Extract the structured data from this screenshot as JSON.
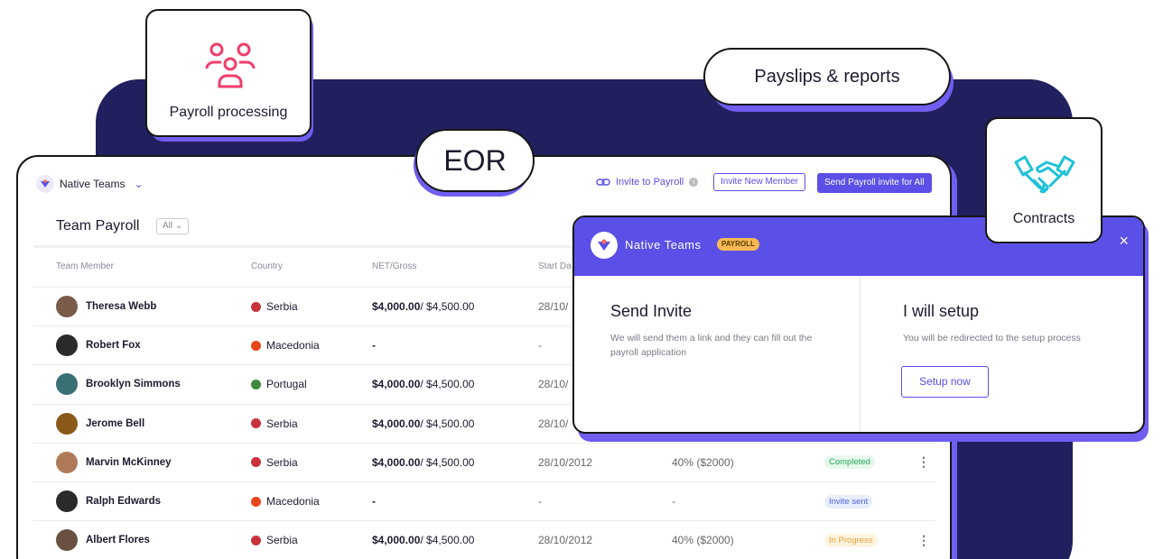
{
  "colors": {
    "brand": "#5a4fe6",
    "panel": "#221f5e",
    "accent_shadow": "#6f5ef0"
  },
  "cards": {
    "payroll_processing": {
      "label": "Payroll processing",
      "icon": "team-icon"
    },
    "payslips": {
      "label": "Payslips & reports"
    },
    "eor": {
      "label": "EOR"
    },
    "contracts": {
      "label": "Contracts",
      "icon": "handshake-icon"
    }
  },
  "app": {
    "brand": "Native Teams",
    "invite_link": "Invite to Payroll",
    "invite_new_member": "Invite New Member",
    "send_payroll_invite": "Send Payroll invite for All",
    "title": "Team Payroll",
    "filter": "All"
  },
  "table": {
    "headers": [
      "Team Member",
      "Country",
      "NET/Gross",
      "Start Da"
    ],
    "rows": [
      {
        "name": "Theresa Webb",
        "country": "Serbia",
        "net": "$4,000.00",
        "gross": " / $4,500.00",
        "date": "28/10/",
        "pct": "",
        "status": "",
        "status_type": "",
        "menu": false,
        "avatar": "#7a5a48",
        "flag": "#c8323c"
      },
      {
        "name": "Robert Fox",
        "country": "Macedonia",
        "net": "-",
        "gross": "",
        "date": "-",
        "pct": "",
        "status": "",
        "status_type": "",
        "menu": false,
        "avatar": "#2a2a2a",
        "flag": "#e8461b"
      },
      {
        "name": "Brooklyn Simmons",
        "country": "Portugal",
        "net": "$4,000.00",
        "gross": " / $4,500.00",
        "date": "28/10/",
        "pct": "",
        "status": "",
        "status_type": "",
        "menu": false,
        "avatar": "#3a6f74",
        "flag": "#3f8a3c"
      },
      {
        "name": "Jerome Bell",
        "country": "Serbia",
        "net": "$4,000.00",
        "gross": " / $4,500.00",
        "date": "28/10/",
        "pct": "",
        "status": "",
        "status_type": "",
        "menu": false,
        "avatar": "#8a5a1a",
        "flag": "#c8323c"
      },
      {
        "name": "Marvin McKinney",
        "country": "Serbia",
        "net": "$4,000.00",
        "gross": " / $4,500.00",
        "date": "28/10/2012",
        "pct": "40% ($2000)",
        "status": "Completed",
        "status_type": "completed",
        "menu": true,
        "avatar": "#b07a5a",
        "flag": "#c8323c"
      },
      {
        "name": "Ralph Edwards",
        "country": "Macedonia",
        "net": "-",
        "gross": "",
        "date": "-",
        "pct": "-",
        "status": "Invite sent",
        "status_type": "sent",
        "menu": false,
        "avatar": "#2a2a2a",
        "flag": "#e8461b"
      },
      {
        "name": "Albert Flores",
        "country": "Serbia",
        "net": "$4,000.00",
        "gross": " / $4,500.00",
        "date": "28/10/2012",
        "pct": "40% ($2000)",
        "status": "In Progress",
        "status_type": "progress",
        "menu": true,
        "avatar": "#6a5040",
        "flag": "#c8323c"
      }
    ]
  },
  "modal": {
    "brand": "Native Teams",
    "tag": "PAYROLL",
    "close": "×",
    "send_invite": {
      "title": "Send Invite",
      "desc": "We will send them a link and they can fill out the payroll application"
    },
    "setup": {
      "title": "I will setup",
      "desc": "You will be redirected to the setup process",
      "button": "Setup now"
    }
  }
}
